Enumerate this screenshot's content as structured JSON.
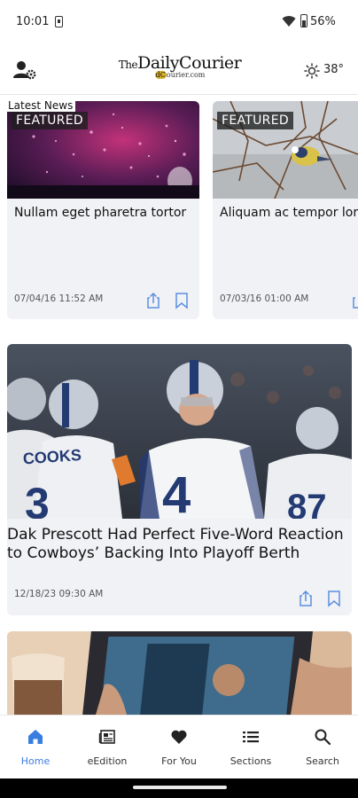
{
  "status_bar": {
    "time": "10:01",
    "battery": "56%"
  },
  "header": {
    "logo_the": "The",
    "logo_name": "DailyCourier",
    "logo_sub_highlight": "dC",
    "logo_sub_rest": "ourier.com",
    "temperature": "38°"
  },
  "section_label": "Latest News",
  "featured_cards": [
    {
      "badge": "FEATURED",
      "title": "Nullam eget pharetra tortor",
      "date": "07/04/16 11:52 AM"
    },
    {
      "badge": "FEATURED",
      "title": "Aliquam ac tempor lorem",
      "date": "07/03/16 01:00 AM"
    }
  ],
  "main_story": {
    "title": "Dak Prescott Had Perfect Five-Word Reaction to Cowboys’ Backing Into Playoff Berth",
    "date": "12/18/23 09:30 AM",
    "jersey_name": "COOKS",
    "jersey_numbers": [
      "3",
      "4",
      "87"
    ]
  },
  "nav": {
    "items": [
      {
        "label": "Home",
        "icon": "home-icon",
        "active": true
      },
      {
        "label": "eEdition",
        "icon": "newspaper-icon",
        "active": false
      },
      {
        "label": "For You",
        "icon": "heart-icon",
        "active": false
      },
      {
        "label": "Sections",
        "icon": "list-icon",
        "active": false
      },
      {
        "label": "Search",
        "icon": "search-icon",
        "active": false
      }
    ]
  },
  "colors": {
    "accent": "#3a7de0",
    "card_bg": "#f1f2f5",
    "icon_blue": "#5b8fe0"
  }
}
